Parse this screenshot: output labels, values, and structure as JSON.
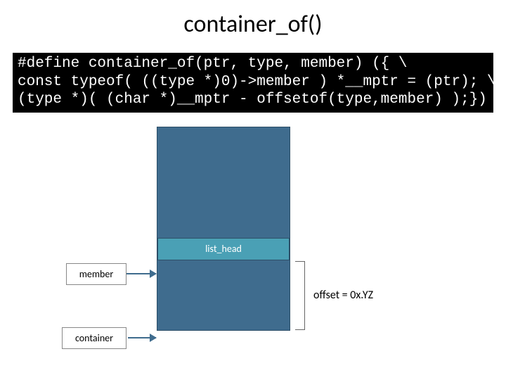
{
  "title": "container_of()",
  "code": "#define container_of(ptr, type, member) ({ \\\nconst typeof( ((type *)0)->member ) *__mptr = (ptr); \\\n(type *)( (char *)__mptr - offsetof(type,member) );})",
  "diagram": {
    "field_label": "list_head",
    "member_label": "member",
    "container_label": "container",
    "offset_label": "offset = 0x.YZ"
  }
}
